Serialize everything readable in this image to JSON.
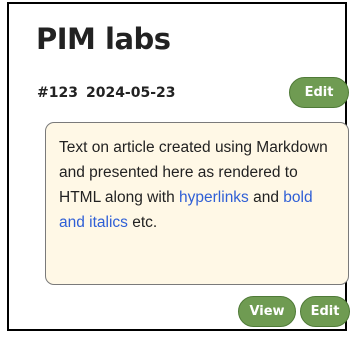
{
  "card": {
    "title": "PIM labs",
    "id": "#123",
    "date": "2024-05-23",
    "edit_label": "Edit"
  },
  "content": {
    "line1": "Text on article created using Markdown and presented here as rendered to HTML along with ",
    "link1": "hyperlinks",
    "and_text": " and ",
    "link2": "bold and italics",
    "tail": " etc."
  },
  "footer": {
    "view_label": "View",
    "edit_label": "Edit"
  },
  "colors": {
    "button_fill": "#6f9b52",
    "content_background": "#fff8e6",
    "link": "#2f5fd6"
  }
}
